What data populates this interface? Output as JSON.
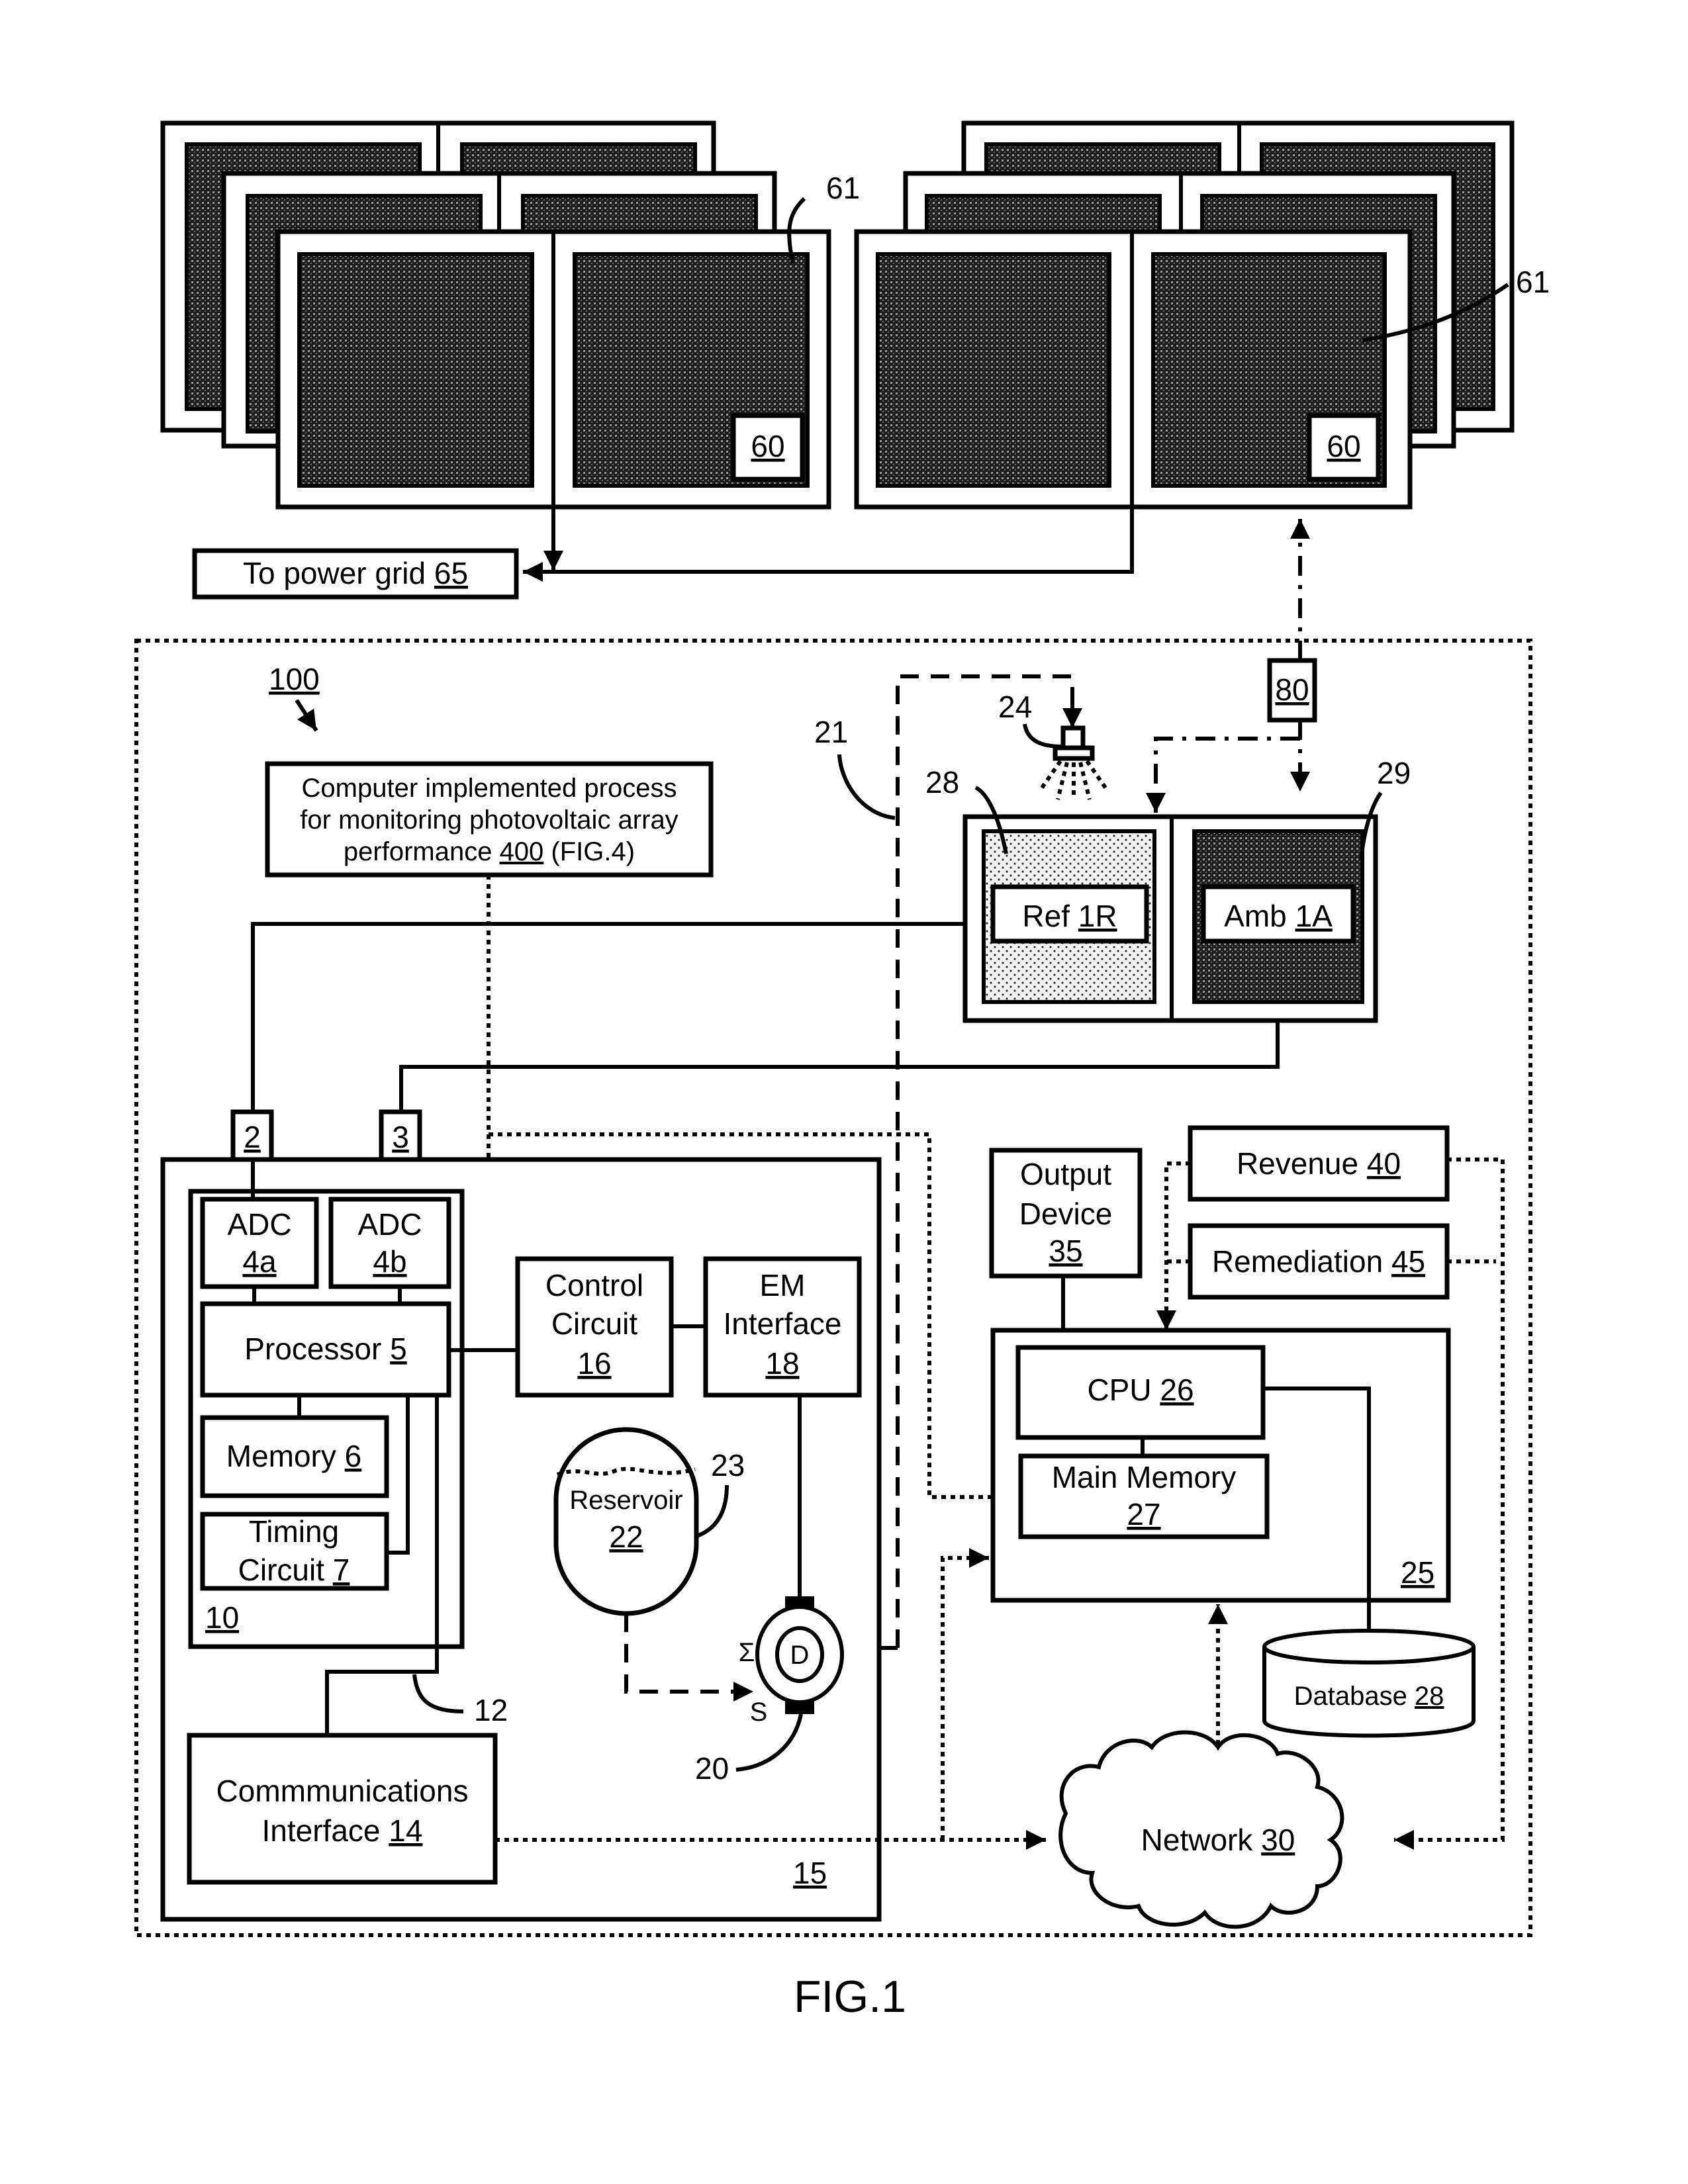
{
  "figure_label": "FIG.1",
  "system_ref": "100",
  "panels": {
    "module_ref": "60",
    "cell_ref": "61"
  },
  "power_grid": {
    "text": "To power grid ",
    "ref": "65"
  },
  "process_box": {
    "line1": "Computer implemented process",
    "line2": "for monitoring photovoltaic array",
    "line3_pre": "performance ",
    "line3_ref": "400",
    "line3_post": " (FIG.4)"
  },
  "conduit_ref": "21",
  "sprayer_ref": "24",
  "ref_coating_ref": "28",
  "amb_coating_ref": "29",
  "box80": "80",
  "ref_cell": {
    "text": "Ref ",
    "ref": "1R"
  },
  "amb_cell": {
    "text": "Amb ",
    "ref": "1A"
  },
  "connectors": {
    "c2": "2",
    "c3": "3"
  },
  "adc_a": {
    "text": "ADC",
    "ref": "4a"
  },
  "adc_b": {
    "text": "ADC",
    "ref": "4b"
  },
  "processor": {
    "text": "Processor ",
    "ref": "5"
  },
  "memory": {
    "text": "Memory ",
    "ref": "6"
  },
  "timing": {
    "line1": "Timing",
    "line2": "Circuit ",
    "ref": "7"
  },
  "module10_ref": "10",
  "bus_ref": "12",
  "comms": {
    "line1": "Commmunications",
    "line2": "Interface ",
    "ref": "14"
  },
  "enclosure_ref": "15",
  "control": {
    "line1": "Control",
    "line2": "Circuit",
    "ref": "16"
  },
  "em": {
    "line1": "EM",
    "line2": "Interface",
    "ref": "18"
  },
  "reservoir": {
    "text": "Reservoir",
    "ref": "22",
    "liquid_ref": "23"
  },
  "pump": {
    "label": "D",
    "sigma": "Σ",
    "s": "S",
    "ref": "20"
  },
  "output_device": {
    "line1": "Output",
    "line2": "Device",
    "ref": "35"
  },
  "revenue": {
    "text": "Revenue ",
    "ref": "40"
  },
  "remediation": {
    "text": "Remediation ",
    "ref": "45"
  },
  "cpu": {
    "text": "CPU ",
    "ref": "26"
  },
  "main_memory": {
    "text": "Main Memory",
    "ref": "27"
  },
  "server_ref": "25",
  "database": {
    "text": "Database ",
    "ref": "28"
  },
  "network": {
    "text": "Network ",
    "ref": "30"
  }
}
